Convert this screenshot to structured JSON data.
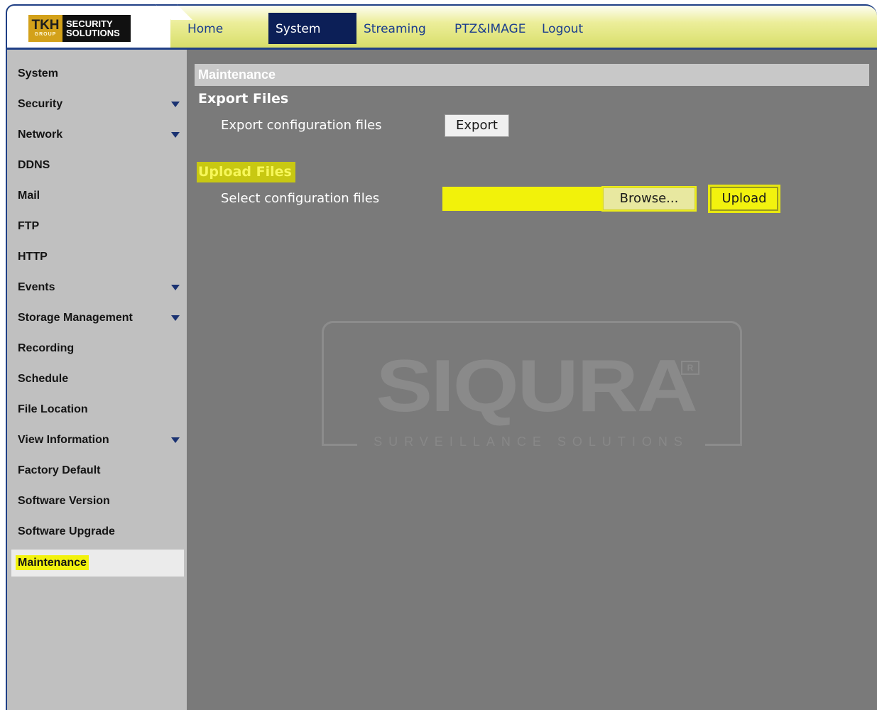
{
  "logo": {
    "brand_short": "TKH",
    "brand_group": "GROUP",
    "brand_line1": "SECURITY",
    "brand_line2": "SOLUTIONS"
  },
  "nav": {
    "tabs": [
      {
        "label": "Home"
      },
      {
        "label": "System",
        "active": true
      },
      {
        "label": "Streaming"
      },
      {
        "label": "PTZ&IMAGE"
      },
      {
        "label": "Logout"
      }
    ]
  },
  "sidebar": {
    "items": [
      {
        "label": "System",
        "has_submenu": false
      },
      {
        "label": "Security",
        "has_submenu": true
      },
      {
        "label": "Network",
        "has_submenu": true
      },
      {
        "label": "DDNS",
        "has_submenu": false
      },
      {
        "label": "Mail",
        "has_submenu": false
      },
      {
        "label": "FTP",
        "has_submenu": false
      },
      {
        "label": "HTTP",
        "has_submenu": false
      },
      {
        "label": "Events",
        "has_submenu": true
      },
      {
        "label": "Storage Management",
        "has_submenu": true
      },
      {
        "label": "Recording",
        "has_submenu": false
      },
      {
        "label": "Schedule",
        "has_submenu": false
      },
      {
        "label": "File Location",
        "has_submenu": false
      },
      {
        "label": "View Information",
        "has_submenu": true
      },
      {
        "label": "Factory Default",
        "has_submenu": false
      },
      {
        "label": "Software Version",
        "has_submenu": false
      },
      {
        "label": "Software Upgrade",
        "has_submenu": false
      },
      {
        "label": "Maintenance",
        "has_submenu": false,
        "active": true
      }
    ]
  },
  "main": {
    "panel_title": "Maintenance",
    "export": {
      "section_title": "Export Files",
      "label": "Export configuration files",
      "button_label": "Export"
    },
    "upload": {
      "section_title": "Upload Files",
      "label": "Select configuration files",
      "file_value": "",
      "browse_label": "Browse...",
      "upload_label": "Upload"
    }
  },
  "watermark": {
    "brand": "SIQURA",
    "registered": "R",
    "tagline": "SURVEILLANCE SOLUTIONS"
  },
  "colors": {
    "nav_text": "#1a3c8e",
    "nav_active_bg": "#0c1f57",
    "sidebar_bg": "#c0c0c0",
    "main_bg": "#7a7a7a",
    "highlight": "#f2f20e"
  }
}
